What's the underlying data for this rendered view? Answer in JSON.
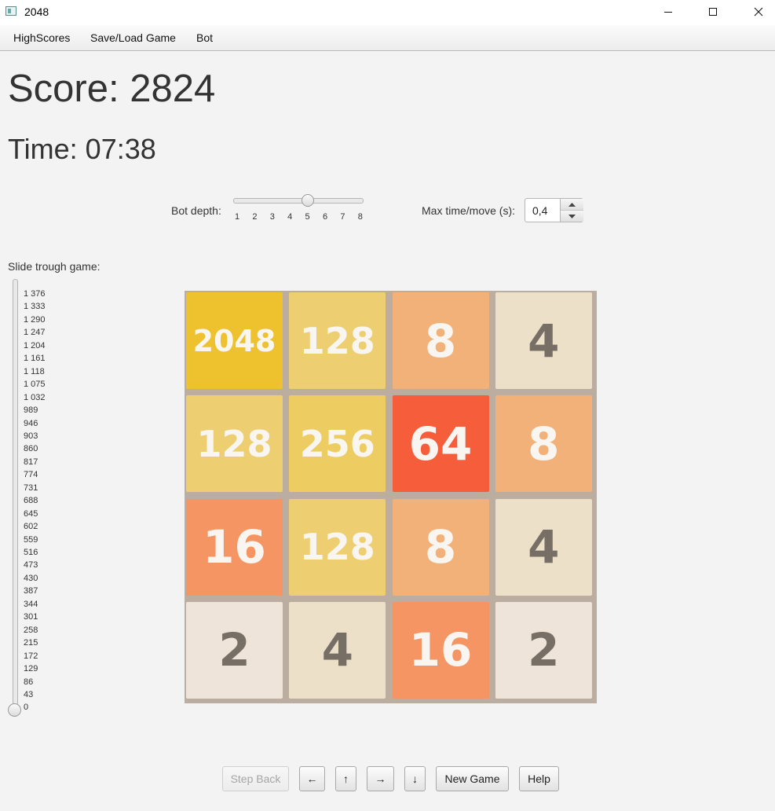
{
  "window": {
    "title": "2048"
  },
  "menu": [
    "HighScores",
    "Save/Load Game",
    "Bot"
  ],
  "score_text": "Score: 2824",
  "time_text": "Time: 07:38",
  "bot_depth": {
    "label": "Bot depth:",
    "ticks": [
      "1",
      "2",
      "3",
      "4",
      "5",
      "6",
      "7",
      "8"
    ],
    "value": 5
  },
  "max_time": {
    "label": "Max time/move (s):",
    "value": "0,4"
  },
  "slide": {
    "label": "Slide trough game:",
    "ticks": [
      "1 376",
      "1 333",
      "1 290",
      "1 247",
      "1 204",
      "1 161",
      "1 118",
      "1 075",
      "1 032",
      "989",
      "946",
      "903",
      "860",
      "817",
      "774",
      "731",
      "688",
      "645",
      "602",
      "559",
      "516",
      "473",
      "430",
      "387",
      "344",
      "301",
      "258",
      "215",
      "172",
      "129",
      "86",
      "43",
      "0"
    ],
    "value": 0
  },
  "board": [
    [
      "2048",
      "128",
      "8",
      "4"
    ],
    [
      "128",
      "256",
      "64",
      "8"
    ],
    [
      "16",
      "128",
      "8",
      "4"
    ],
    [
      "2",
      "4",
      "16",
      "2"
    ]
  ],
  "buttons": {
    "step_back": "Step Back",
    "left": "←",
    "up": "↑",
    "right": "→",
    "down": "↓",
    "new_game": "New Game",
    "help": "Help"
  },
  "tile_colors": {
    "2": "#eee4da",
    "4": "#ede0c8",
    "8": "#f2b179",
    "16": "#f59563",
    "64": "#f65e3b",
    "128": "#edcf72",
    "256": "#edcc61",
    "2048": "#edc22e"
  },
  "tile_text_colors": {
    "dark": "#776e65",
    "light": "#f9f6f2"
  }
}
